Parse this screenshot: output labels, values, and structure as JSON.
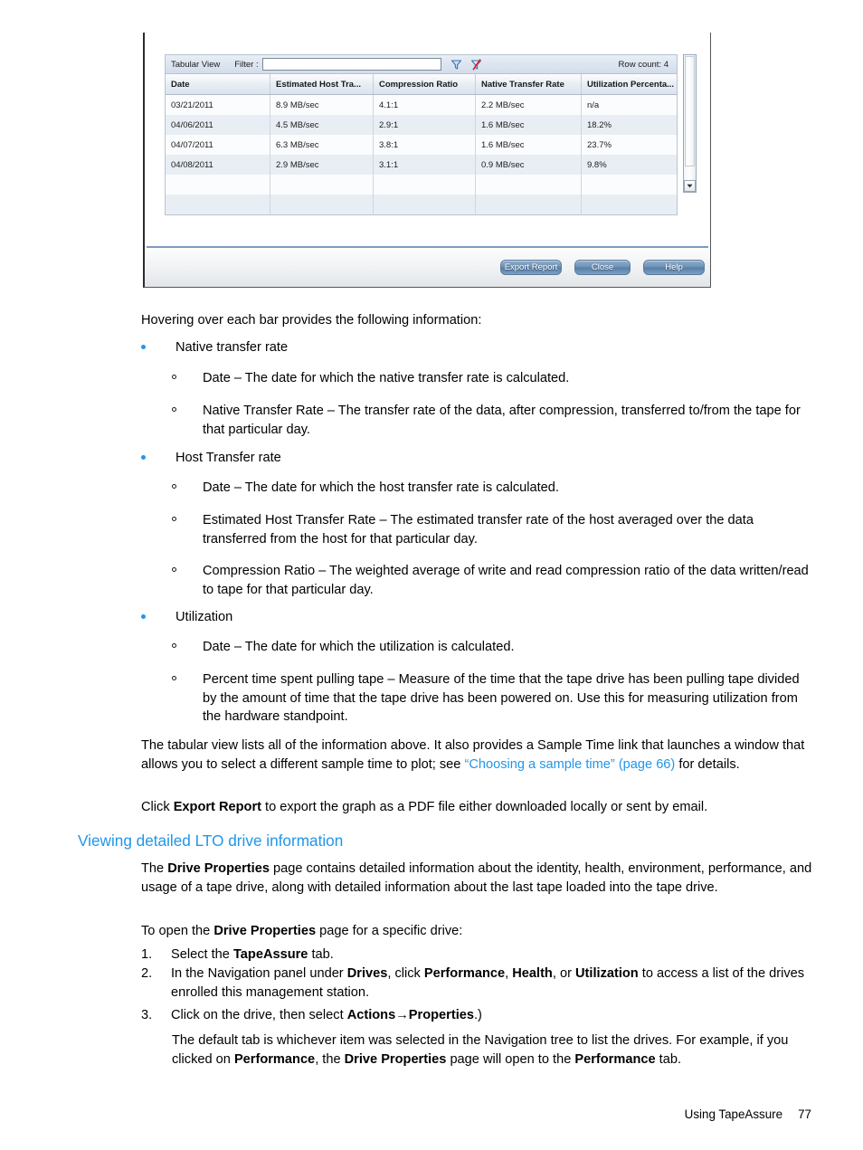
{
  "dialog": {
    "toolbar": {
      "view_label": "Tabular View",
      "filter_label": "Filter :",
      "filter_value": "",
      "filter_placeholder": "",
      "apply_filter_icon": "filter-funnel-icon",
      "clear_filter_icon": "clear-filter-icon",
      "row_count": "Row count: 4"
    },
    "table": {
      "columns": [
        "Date",
        "Estimated Host Tra...",
        "Compression Ratio",
        "Native Transfer Rate",
        "Utilization Percenta..."
      ],
      "rows": [
        [
          "03/21/2011",
          "8.9 MB/sec",
          "4.1:1",
          "2.2 MB/sec",
          "n/a"
        ],
        [
          "04/06/2011",
          "4.5 MB/sec",
          "2.9:1",
          "1.6 MB/sec",
          "18.2%"
        ],
        [
          "04/07/2011",
          "6.3 MB/sec",
          "3.8:1",
          "1.6 MB/sec",
          "23.7%"
        ],
        [
          "04/08/2011",
          "2.9 MB/sec",
          "3.1:1",
          "0.9 MB/sec",
          "9.8%"
        ],
        [
          "",
          "",
          "",
          "",
          ""
        ],
        [
          "",
          "",
          "",
          "",
          ""
        ]
      ]
    },
    "buttons": {
      "export": "Export Report",
      "close": "Close",
      "help": "Help"
    }
  },
  "body": {
    "intro": "Hovering over each bar provides the following information:",
    "bullets": [
      {
        "label": "Native transfer rate"
      },
      {
        "label": "Host Transfer rate"
      },
      {
        "label": "Utilization"
      }
    ],
    "sub_native_1": "Date – The date for which the native transfer rate is calculated.",
    "sub_native_2": "Native Transfer Rate – The transfer rate of the data, after compression, transferred to/from the tape for that particular day.",
    "sub_host_1": "Date – The date for which the host transfer rate is calculated.",
    "sub_host_2": "Estimated Host Transfer Rate – The estimated transfer rate of the host averaged over the data transferred from the host for that particular day.",
    "sub_host_3": "Compression Ratio – The weighted average of write and read compression ratio of the data written/read to tape for that particular day.",
    "sub_util_1": "Date – The date for which the utilization is calculated.",
    "sub_util_2": "Percent time spent pulling tape – Measure of the time that the tape drive has been pulling tape divided by the amount of time that the tape drive has been powered on. Use this for measuring utilization from the hardware standpoint.",
    "tabular_para_1": "The tabular view lists all of the information above. It also provides a Sample Time link that launches a window that allows you to select a different sample time to plot; see ",
    "tabular_link_1": "“Choosing a sample time”",
    "tabular_link_2": "(page 66)",
    "tabular_para_2": " for details.",
    "export_para_1": "Click ",
    "export_para_bold": "Export Report",
    "export_para_2": " to export the graph as a PDF file either downloaded locally or sent by email."
  },
  "section": {
    "heading": "Viewing detailed LTO drive information",
    "p1_a": "The ",
    "p1_b": "Drive Properties",
    "p1_c": " page contains detailed information about the identity, health, environment, performance, and usage of a tape drive, along with detailed information about the last tape loaded into the tape drive.",
    "p2_a": "To open the ",
    "p2_b": "Drive Properties",
    "p2_c": " page for a specific drive:",
    "steps": [
      {
        "marker": "1.",
        "a": "Select the ",
        "b": "TapeAssure",
        "c": " tab."
      },
      {
        "marker": "2.",
        "a": "In the Navigation panel under ",
        "b": "Drives",
        "c": ", click ",
        "d": "Performance",
        "e": ", ",
        "f": "Health",
        "g": ", or ",
        "h": "Utilization",
        "i": " to access a list of the drives enrolled this management station."
      },
      {
        "marker": "3.",
        "a": "Click on the drive, then select ",
        "b": "Actions",
        "arrow": "→",
        "c": "Properties",
        "d": ".)"
      }
    ],
    "p3_a": "The default tab is whichever item was selected in the Navigation tree to list the drives. For example, if you clicked on ",
    "p3_b": "Performance",
    "p3_c": ", the ",
    "p3_d": "Drive Properties",
    "p3_e": " page will open to the ",
    "p3_f": "Performance",
    "p3_g": " tab."
  },
  "footer": {
    "chapter": "Using TapeAssure",
    "page_number": "77"
  }
}
